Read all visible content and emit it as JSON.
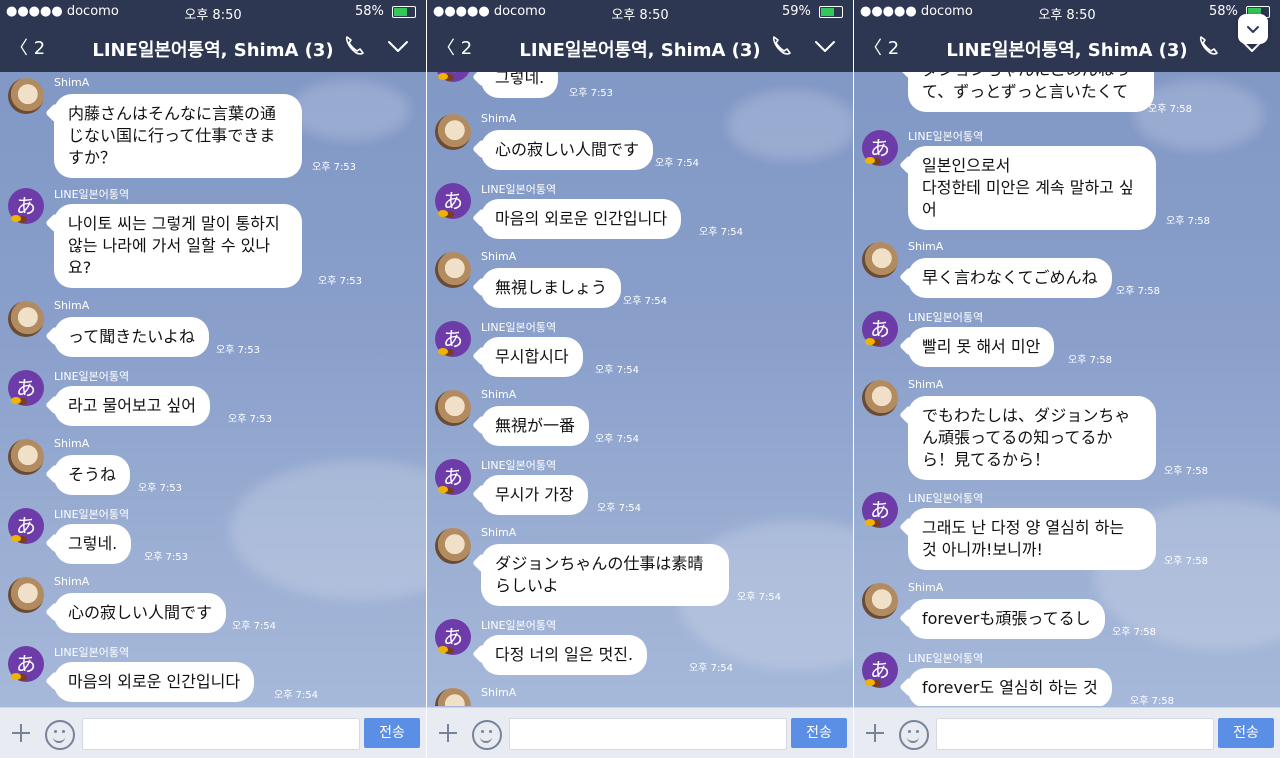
{
  "panels": [
    {
      "status": {
        "carrier": "●●●●● docomo",
        "time": "오후 8:50",
        "battery": "58%",
        "battery_level": 58
      },
      "nav": {
        "back": "〈 2",
        "title": "LINE일본어통역, ShimA (3)"
      },
      "messages": [
        {
          "kind": "user",
          "sender": "ShimA",
          "text": "内藤さんはそんなに言葉の通じない国に行って仕事できますか？",
          "time": "오후 7:53"
        },
        {
          "kind": "line",
          "sender": "LINE일본어통역",
          "text": "나이토 씨는 그렇게 말이 통하지 않는 나라에 가서 일할 수 있나요?",
          "time": "오후 7:53"
        },
        {
          "kind": "user",
          "sender": "ShimA",
          "text": "って聞きたいよね",
          "time": "오후 7:53"
        },
        {
          "kind": "line",
          "sender": "LINE일본어통역",
          "text": "라고 물어보고 싶어",
          "time": "오후 7:53"
        },
        {
          "kind": "user",
          "sender": "ShimA",
          "text": "そうね",
          "time": "오후 7:53"
        },
        {
          "kind": "line",
          "sender": "LINE일본어통역",
          "text": "그렇네.",
          "time": "오후 7:53"
        },
        {
          "kind": "user",
          "sender": "ShimA",
          "text": "心の寂しい人間です",
          "time": "오후 7:54"
        },
        {
          "kind": "line",
          "sender": "LINE일본어통역",
          "text": "마음의 외로운 인간입니다",
          "time": "오후 7:54"
        }
      ],
      "input": {
        "send_label": "전송"
      }
    },
    {
      "status": {
        "carrier": "●●●●● docomo",
        "time": "오후 8:50",
        "battery": "59%",
        "battery_level": 59
      },
      "nav": {
        "back": "〈 2",
        "title": "LINE일본어통역, ShimA (3)"
      },
      "messages": [
        {
          "kind": "line",
          "sender": "",
          "text": "그렇네.",
          "time": "오후 7:53"
        },
        {
          "kind": "user",
          "sender": "ShimA",
          "text": "心の寂しい人間です",
          "time": "오후 7:54"
        },
        {
          "kind": "line",
          "sender": "LINE일본어통역",
          "text": "마음의 외로운 인간입니다",
          "time": "오후 7:54"
        },
        {
          "kind": "user",
          "sender": "ShimA",
          "text": "無視しましょう",
          "time": "오후 7:54"
        },
        {
          "kind": "line",
          "sender": "LINE일본어통역",
          "text": "무시합시다",
          "time": "오후 7:54"
        },
        {
          "kind": "user",
          "sender": "ShimA",
          "text": "無視が一番",
          "time": "오후 7:54"
        },
        {
          "kind": "line",
          "sender": "LINE일본어통역",
          "text": "무시가 가장",
          "time": "오후 7:54"
        },
        {
          "kind": "user",
          "sender": "ShimA",
          "text": "ダジョンちゃんの仕事は素晴らしいよ",
          "time": "오후 7:54"
        },
        {
          "kind": "line",
          "sender": "LINE일본어통역",
          "text": "다정 너의 일은 멋진.",
          "time": "오후 7:54"
        },
        {
          "kind": "user",
          "sender": "ShimA",
          "text": "",
          "time": ""
        }
      ],
      "input": {
        "send_label": "전송"
      }
    },
    {
      "status": {
        "carrier": "●●●●● docomo",
        "time": "오후 8:50",
        "battery": "58%",
        "battery_level": 58
      },
      "nav": {
        "back": "〈 2",
        "title": "LINE일본어통역, ShimA (3)"
      },
      "messages": [
        {
          "kind": "user",
          "sender": "",
          "text": "ダジョンちゃんにごめんねって、ずっとずっと言いたくて",
          "time": "오후 7:58"
        },
        {
          "kind": "line",
          "sender": "LINE일본어통역",
          "text": "일본인으로서\n다정한테 미안은 계속 말하고 싶어",
          "time": "오후 7:58"
        },
        {
          "kind": "user",
          "sender": "ShimA",
          "text": "早く言わなくてごめんね",
          "time": "오후 7:58"
        },
        {
          "kind": "line",
          "sender": "LINE일본어통역",
          "text": "빨리 못 해서 미안",
          "time": "오후 7:58"
        },
        {
          "kind": "user",
          "sender": "ShimA",
          "text": "でもわたしは、ダジョンちゃん頑張ってるの知ってるから！見てるから！",
          "time": "오후 7:58"
        },
        {
          "kind": "line",
          "sender": "LINE일본어통역",
          "text": "그래도 난 다정 양 열심히 하는 것 아니까!보니까!",
          "time": "오후 7:58"
        },
        {
          "kind": "user",
          "sender": "ShimA",
          "text": "foreverも頑張ってるし",
          "time": "오후 7:58"
        },
        {
          "kind": "line",
          "sender": "LINE일본어통역",
          "text": "forever도 열심히 하는 것",
          "time": "오후 7:58"
        }
      ],
      "input": {
        "send_label": "전송"
      }
    }
  ]
}
